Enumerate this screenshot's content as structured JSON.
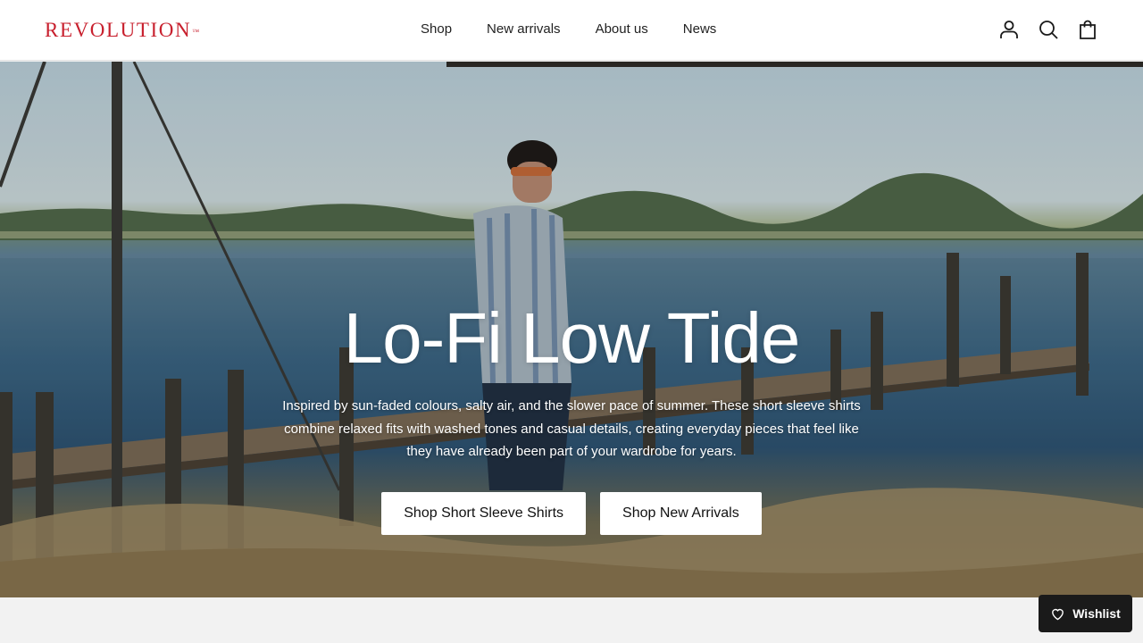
{
  "brand": {
    "name": "REVOLUTION",
    "trademark": "™",
    "color": "#c8202e"
  },
  "nav": {
    "items": [
      {
        "label": "Shop"
      },
      {
        "label": "New arrivals"
      },
      {
        "label": "About us"
      },
      {
        "label": "News"
      }
    ]
  },
  "header_icons": [
    "account-icon",
    "search-icon",
    "cart-icon"
  ],
  "hero": {
    "title": "Lo-Fi Low Tide",
    "text": "Inspired by sun-faded colours, salty air, and the slower pace of summer. These short sleeve shirts combine relaxed fits with washed tones and casual details, creating everyday pieces that feel like they have already been part of your wardrobe for years.",
    "buttons": [
      {
        "label": "Shop Short Sleeve Shirts"
      },
      {
        "label": "Shop New Arrivals"
      }
    ]
  },
  "wishlist": {
    "label": "Wishlist",
    "icon": "heart-icon"
  }
}
